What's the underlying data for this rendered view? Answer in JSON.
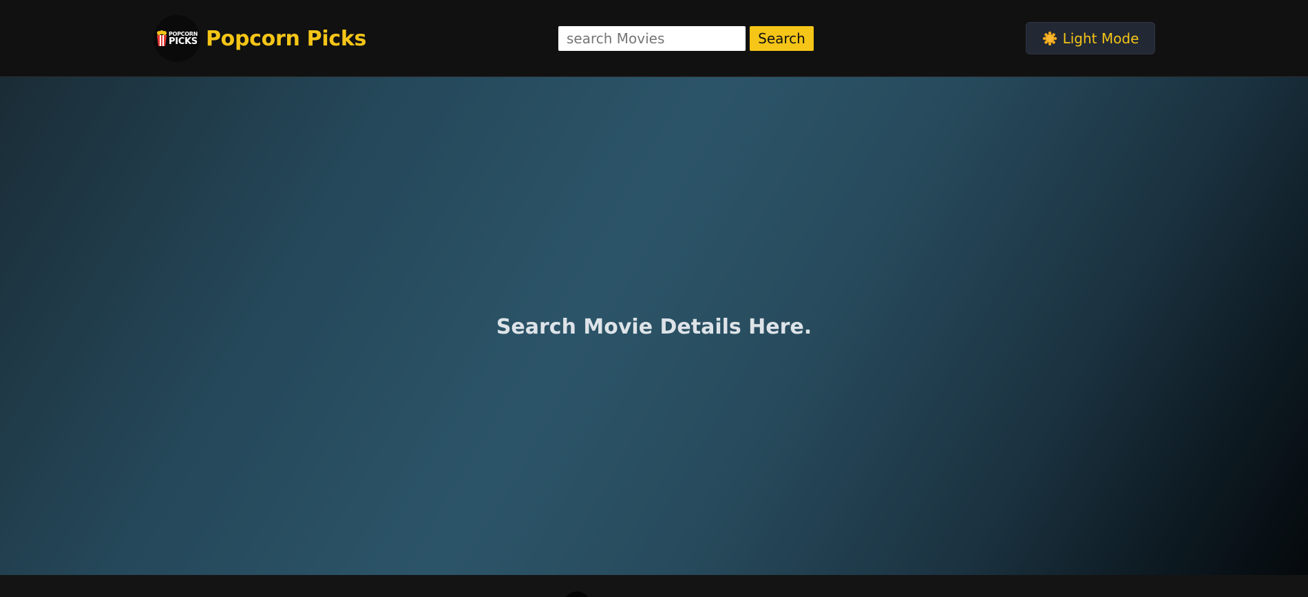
{
  "header": {
    "logo": {
      "line1": "POPCORN",
      "line2": "PICKS",
      "icon": "popcorn-bucket-icon"
    },
    "brand_title": "Popcorn Picks",
    "search": {
      "placeholder": "search Movies",
      "value": "",
      "button_label": "Search"
    },
    "mode_toggle": {
      "icon": "sun-icon",
      "label": "Light Mode"
    }
  },
  "hero": {
    "message": "Search Movie Details Here."
  },
  "colors": {
    "accent": "#f5c518",
    "header_bg": "#111111",
    "toggle_bg": "#222834",
    "hero_text": "#dde3e8"
  }
}
